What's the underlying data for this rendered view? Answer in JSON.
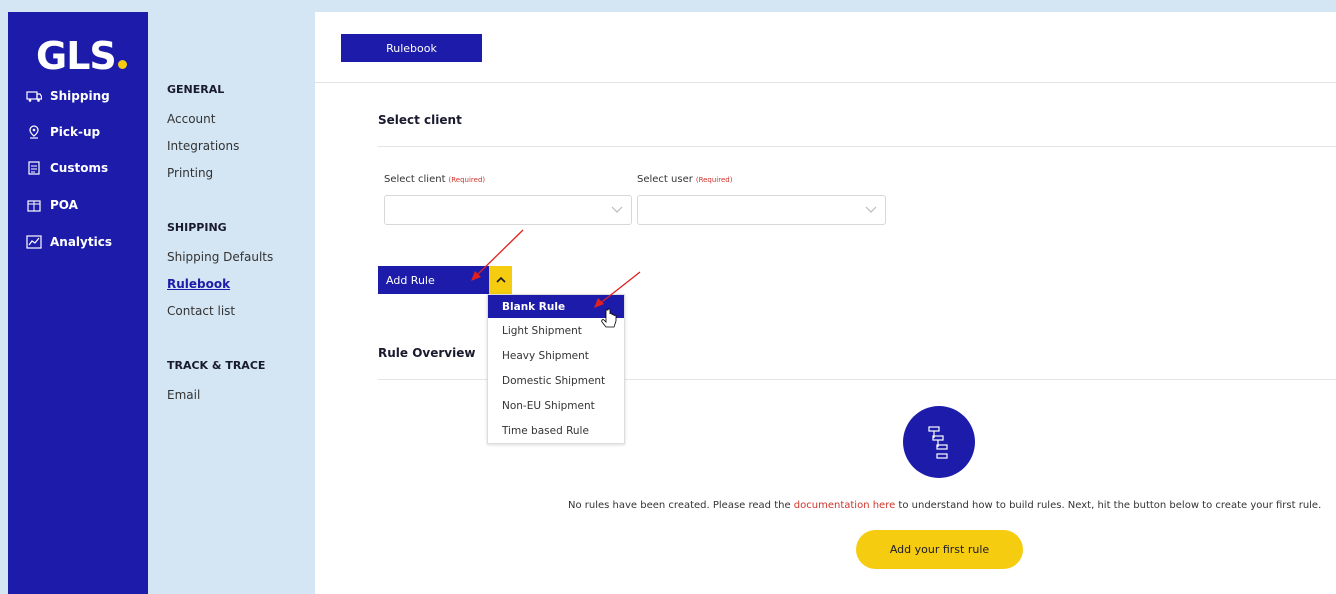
{
  "brand": {
    "logo_text": "GLS",
    "accent": "#f5cc10",
    "primary": "#1d1caa"
  },
  "nav": {
    "items": [
      {
        "label": "Shipping",
        "icon": "truck-icon"
      },
      {
        "label": "Pick-up",
        "icon": "location-pin-icon"
      },
      {
        "label": "Customs",
        "icon": "document-icon"
      },
      {
        "label": "POA",
        "icon": "package-icon"
      },
      {
        "label": "Analytics",
        "icon": "chart-icon"
      }
    ]
  },
  "subnav": {
    "general": {
      "heading": "GENERAL",
      "items": [
        "Account",
        "Integrations",
        "Printing"
      ]
    },
    "shipping": {
      "heading": "SHIPPING",
      "items": [
        "Shipping Defaults",
        "Rulebook",
        "Contact list"
      ],
      "active": "Rulebook"
    },
    "track": {
      "heading": "TRACK & TRACE",
      "items": [
        "Email"
      ]
    }
  },
  "main": {
    "tab_label": "Rulebook",
    "select_client_section": "Select client",
    "client_field": {
      "label": "Select client",
      "required": "(Required)",
      "value": ""
    },
    "user_field": {
      "label": "Select user",
      "required": "(Required)",
      "value": ""
    },
    "add_rule_label": "Add Rule",
    "dropdown": [
      "Blank Rule",
      "Light Shipment",
      "Heavy Shipment",
      "Domestic Shipment",
      "Non-EU Shipment",
      "Time based Rule"
    ],
    "dropdown_highlighted": "Blank Rule",
    "rule_overview_title": "Rule Overview",
    "empty": {
      "text_before": "No rules have been created. Please read the ",
      "link": "documentation here",
      "text_after": " to understand how to build rules. Next, hit the button below to create your first rule."
    },
    "first_rule_button": "Add your first rule"
  }
}
